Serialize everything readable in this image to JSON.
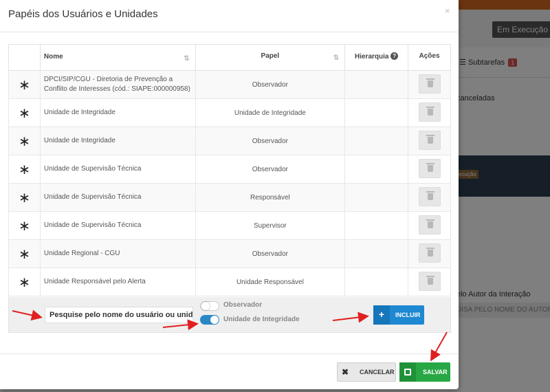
{
  "background": {
    "status_label": "Em Execução - ",
    "subtabs_label": "Subtarefas",
    "subtabs_count": "1",
    "canceladas_label": "canceladas",
    "execucao_badge": "ecução",
    "autor_label": "elo Autor da Interação",
    "autor_placeholder": "UISA PELO NOME DO AUTOR"
  },
  "modal": {
    "title": "Papéis dos Usuários e Unidades",
    "close": "×",
    "columns": {
      "nome": "Nome",
      "papel": "Papel",
      "hierarquia": "Hierarquia",
      "acoes": "Ações"
    },
    "rows": [
      {
        "marker": "∗",
        "nome": "DPCI/SIP/CGU - Diretoria de Prevenção a Conflito de Interesses (cód.: SIAPE:000000958)",
        "papel": "Observador",
        "hierarquia": ""
      },
      {
        "marker": "∗",
        "nome": "Unidade de Integridade",
        "papel": "Unidade de Integridade",
        "hierarquia": ""
      },
      {
        "marker": "∗",
        "nome": "Unidade de Integridade",
        "papel": "Observador",
        "hierarquia": ""
      },
      {
        "marker": "∗",
        "nome": "Unidade de Supervisão Técnica",
        "papel": "Observador",
        "hierarquia": ""
      },
      {
        "marker": "∗",
        "nome": "Unidade de Supervisão Técnica",
        "papel": "Responsável",
        "hierarquia": ""
      },
      {
        "marker": "∗",
        "nome": "Unidade de Supervisão Técnica",
        "papel": "Supervisor",
        "hierarquia": ""
      },
      {
        "marker": "∗",
        "nome": "Unidade Regional - CGU",
        "papel": "Observador",
        "hierarquia": ""
      },
      {
        "marker": "∗",
        "nome": "Unidade Responsável pelo Alerta",
        "papel": "Unidade Responsável",
        "hierarquia": ""
      }
    ],
    "add_row": {
      "search_value": "Pesquise pelo nome do usuário ou unida",
      "toggle_observador": {
        "label": "Observador",
        "on": false
      },
      "toggle_integridade": {
        "label": "Unidade de Integridade",
        "on": true
      },
      "incluir_label": "INCLUIR"
    },
    "footer": {
      "cancelar_label": "CANCELAR",
      "salvar_label": "SALVAR"
    }
  },
  "colors": {
    "primary": "#1e88d2",
    "success": "#28a745",
    "annotation_arrow": "#e02020"
  }
}
